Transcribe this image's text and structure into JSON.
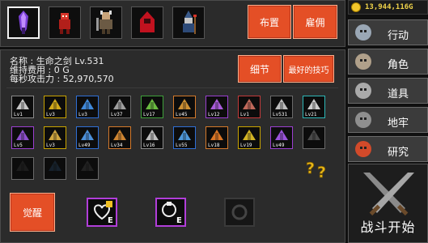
{
  "heroes": [
    {
      "name": "sword",
      "icon": "crystal-sword-icon"
    },
    {
      "name": "red-warrior",
      "icon": "red-warrior-icon"
    },
    {
      "name": "barbarian",
      "icon": "barbarian-icon"
    },
    {
      "name": "red-hood",
      "icon": "red-hood-icon"
    },
    {
      "name": "mage",
      "icon": "mage-icon"
    }
  ],
  "buttons": {
    "formation": "布置",
    "hire": "雇佣",
    "details": "细节",
    "best_skills": "最好的技巧",
    "awaken": "觉醒"
  },
  "info": {
    "name_line": "名称 : 生命之剑 Lv.531",
    "upkeep_line": "维持费用 : 0 G",
    "dps_line": "每秒攻击力 : 52,970,570"
  },
  "skills_row1": [
    {
      "lv": "Lv1",
      "color": "sk-white",
      "icon": "spear-icon"
    },
    {
      "lv": "Lv3",
      "color": "sk-yellow",
      "icon": "up-arrow-icon"
    },
    {
      "lv": "Lv3",
      "color": "sk-blue",
      "icon": "blue-arrow-icon"
    },
    {
      "lv": "Lv37",
      "color": "sk-gray",
      "icon": "hammer-icon"
    },
    {
      "lv": "Lv17",
      "color": "sk-green",
      "icon": "green-slash-icon"
    },
    {
      "lv": "Lv45",
      "color": "sk-orange",
      "icon": "crossed-blades-icon"
    },
    {
      "lv": "Lv12",
      "color": "sk-purple",
      "icon": "purple-burst-icon"
    },
    {
      "lv": "Lv1",
      "color": "sk-red",
      "icon": "meat-icon"
    },
    {
      "lv": "Lv531",
      "color": "sk-gray",
      "icon": "shuriken-icon"
    },
    {
      "lv": "Lv21",
      "color": "sk-cyan",
      "icon": "stars-icon"
    }
  ],
  "skills_row2": [
    {
      "lv": "Lv5",
      "color": "sk-purple",
      "icon": "purple-sword-icon"
    },
    {
      "lv": "Lv3",
      "color": "sk-yellow",
      "icon": "bell-icon"
    },
    {
      "lv": "Lv49",
      "color": "sk-blue",
      "icon": "blue-orb-icon"
    },
    {
      "lv": "Lv34",
      "color": "sk-orange",
      "icon": "claw-icon"
    },
    {
      "lv": "Lv16",
      "color": "sk-white",
      "icon": "shield-icon"
    },
    {
      "lv": "Lv55",
      "color": "sk-blue",
      "icon": "blue-claw-icon"
    },
    {
      "lv": "Lv18",
      "color": "sk-orange",
      "icon": "fire-arrow-icon"
    },
    {
      "lv": "Lv19",
      "color": "sk-yellow",
      "icon": "gold-arrow-icon"
    },
    {
      "lv": "Lv49",
      "color": "sk-purple",
      "icon": "purple-down-icon"
    },
    {
      "lv": "",
      "color": "sk-gray",
      "icon": "dark-shield-icon"
    }
  ],
  "skills_row3": [
    {
      "lv": "",
      "color": "sk-gray",
      "icon": "dark-slash-icon"
    },
    {
      "lv": "",
      "color": "sk-gray",
      "icon": "dark-wave-icon"
    },
    {
      "lv": "",
      "color": "sk-gray",
      "icon": "music-note-icon"
    }
  ],
  "equip": [
    {
      "icon": "heart-gem-icon",
      "tag": "E"
    },
    {
      "icon": "ring-gem-icon",
      "tag": "E"
    },
    {
      "icon": "empty-slot-icon",
      "tag": ""
    }
  ],
  "gold": "13,944,116G",
  "menu": [
    {
      "label": "行动",
      "icon": "knight-helm-icon"
    },
    {
      "label": "角色",
      "icon": "demon-mask-icon"
    },
    {
      "label": "道具",
      "icon": "armor-icon"
    },
    {
      "label": "地牢",
      "icon": "dungeon-icon"
    },
    {
      "label": "研究",
      "icon": "potion-icon"
    }
  ],
  "battle_label": "战斗开始"
}
